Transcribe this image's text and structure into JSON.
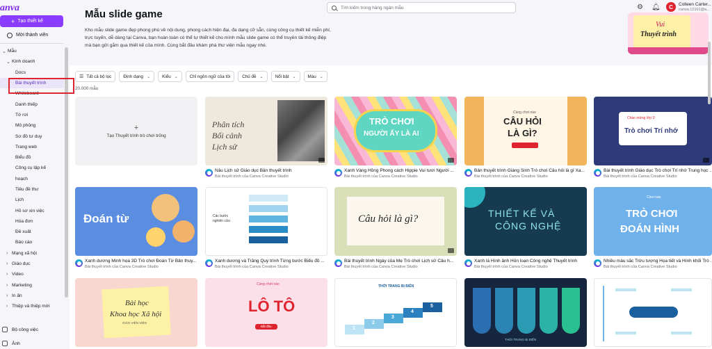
{
  "brand": {
    "logo": "anva",
    "accent": "#8b3dff"
  },
  "sidebar": {
    "create_label": "Tạo thiết kế",
    "invite_label": "Mời thành viên",
    "nav": [
      {
        "label": "Mẫu",
        "level": 0,
        "chev": "⌄"
      },
      {
        "label": "Kinh doanh",
        "level": 1,
        "chev": "⌄"
      },
      {
        "label": "Docs",
        "level": 2
      },
      {
        "label": "Bài thuyết trình",
        "level": 2,
        "active": true
      },
      {
        "label": "Whiteboard",
        "level": 2
      },
      {
        "label": "Danh thiếp",
        "level": 2
      },
      {
        "label": "Tờ rơi",
        "level": 2
      },
      {
        "label": "Mô phỏng",
        "level": 2
      },
      {
        "label": "Sơ đồ tư duy",
        "level": 2
      },
      {
        "label": "Trang web",
        "level": 2
      },
      {
        "label": "Biểu đồ",
        "level": 2
      },
      {
        "label": "Công cụ lập kế",
        "level": 2
      },
      {
        "label": "hoạch",
        "level": 2
      },
      {
        "label": "Tiêu đề thư",
        "level": 2
      },
      {
        "label": "Lịch",
        "level": 2
      },
      {
        "label": "Hồ sơ xin việc",
        "level": 2
      },
      {
        "label": "Hóa đơn",
        "level": 2
      },
      {
        "label": "Đề xuất",
        "level": 2
      },
      {
        "label": "Báo cáo",
        "level": 2
      },
      {
        "label": "Mạng xã hội",
        "level": 1,
        "chev": "›"
      },
      {
        "label": "Giáo dục",
        "level": 1,
        "chev": "›"
      },
      {
        "label": "Video",
        "level": 1,
        "chev": "›"
      },
      {
        "label": "Marketing",
        "level": 1,
        "chev": "›"
      },
      {
        "label": "In ấn",
        "level": 1,
        "chev": "›"
      },
      {
        "label": "Thiệp và thiệp mời",
        "level": 1,
        "chev": "›"
      }
    ],
    "bottom": [
      "Bộ công việc",
      "Ảnh"
    ]
  },
  "header": {
    "search_placeholder": "Tìm kiếm trong hàng ngàn mẫu",
    "avatar_letter": "C",
    "user_name": "Colleen Carter...",
    "user_email": "canva.12101@a..."
  },
  "hero": {
    "title": "Mẫu slide game",
    "description": "Kho mẫu slide game đẹp phong phú về nội dung, phong cách hiện đại, đa dạng cỡ sẵn, cùng công cụ thiết kế miễn phí, trực tuyến, dễ dàng tại Canva, bạn hoàn toàn có thể tự thiết kế cho mình mẫu slide game có thể truyền tải thông điệp mà bạn gửi gắm qua thiết kế của mình. Cùng bắt đầu khám phá thư viện mẫu ngay nhé.",
    "card_line1": "Vui",
    "card_line2": "Thuyết trình"
  },
  "filters": [
    "Tất cả bộ lọc",
    "Định dạng",
    "Kiểu",
    "Chỉ ngôn ngữ của tôi",
    "Chủ đề",
    "Nổi bật",
    "Màu"
  ],
  "result_count": "20.000 mẫu",
  "blank_card": "Tạo Thuyết trình trò chơi trống",
  "creator": "Bài thuyết trình của Canva Creative Studio",
  "cards": [
    {
      "title": "Nâu Lịch sử Giáo dục Bản thuyết trình",
      "thumb": [
        "Phân tích",
        "Bối cảnh",
        "Lịch sử"
      ]
    },
    {
      "title": "Xanh Vàng Hồng Phong cách Hippie Vui tươi Người ...",
      "thumb": [
        "TRÒ CHƠI",
        "NGƯỜI ẤY LÀ AI"
      ]
    },
    {
      "title": "Bản thuyết trình Giáng Sinh Trò chơi Câu hỏi là gì Xa...",
      "thumb": [
        "Cùng chơi nào",
        "CÂU HỎI",
        "LÀ GÌ?"
      ]
    },
    {
      "title": "Bài thuyết trình Giáo dục Trò chơi Trí nhớ Trung học ...",
      "thumb": [
        "Chào mừng lớp 1!",
        "Trò chơi Trí nhớ"
      ]
    },
    {
      "title": "Xanh dương Minh họa 3D Trò chơi Đoán Từ Bản thuy...",
      "thumb": [
        "Đoán từ"
      ]
    },
    {
      "title": "Xanh dương và Trắng Quy trình Từng bước Biểu đồ ...",
      "thumb": [
        "Các bước",
        "nghiên cứu"
      ]
    },
    {
      "title": "Bài thuyết trình Ngày của Mẹ Trò chơi Lịch sử Câu h...",
      "thumb": [
        "Câu hỏi là gì?"
      ]
    },
    {
      "title": "Xanh lá Hình ảnh Hỗn loạn Công nghệ Thuyết trình",
      "thumb": [
        "THIẾT KẾ VÀ",
        "CÔNG NGHỆ"
      ]
    },
    {
      "title": "Nhiều màu sắc Trừu tượng Họa tiết và Hình khối Trò ...",
      "thumb": [
        "Chơi nào",
        "TRÒ CHƠI",
        "ĐOÁN HÌNH"
      ]
    },
    {
      "title": "",
      "thumb": [
        "Bài học",
        "Khoa học Xã hội",
        "GIÁO VIÊN VIÊN"
      ]
    },
    {
      "title": "",
      "thumb": [
        "Cùng chơi nào",
        "LÔ TÔ",
        "Bắt đầu"
      ]
    },
    {
      "title": "",
      "thumb": [
        "THỜI TRANG BỊ BIẾN",
        "1",
        "2",
        "3",
        "4",
        "5"
      ]
    },
    {
      "title": "",
      "thumb": [
        "THỜI TRANG BỊ BIẾN"
      ]
    },
    {
      "title": "",
      "thumb": []
    }
  ]
}
